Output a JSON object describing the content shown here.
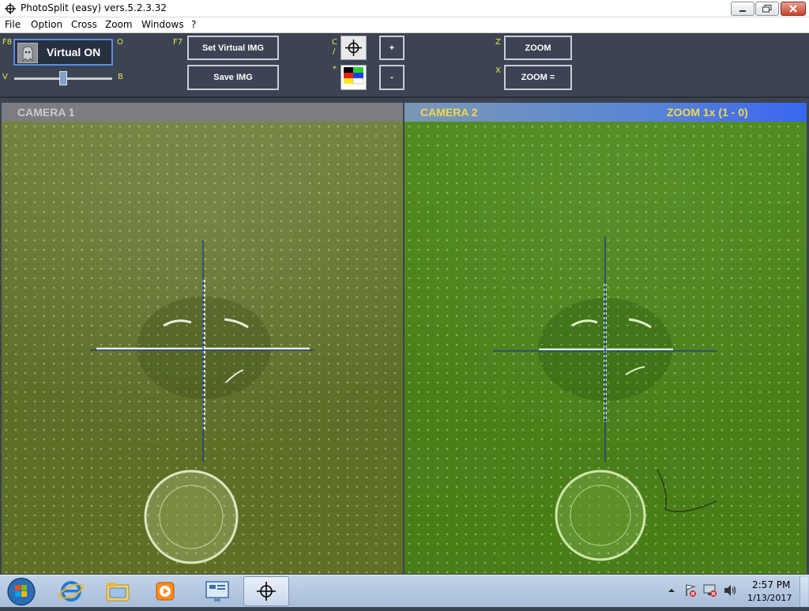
{
  "window": {
    "title": "PhotoSplit  (easy)  vers.5.2.3.32"
  },
  "menu": {
    "items": [
      "File",
      "Option",
      "Cross",
      "Zoom",
      "Windows",
      "?"
    ]
  },
  "toolbar": {
    "hotkeys": {
      "f8": "F8",
      "f7": "F7",
      "o": "O",
      "v": "V",
      "b": "B",
      "c": "C",
      "slash": "/",
      "star": "*",
      "z": "Z",
      "x": "X"
    },
    "virtual_label": "Virtual ON",
    "slider_value": 0.5,
    "set_virtual_label": "Set Virtual IMG",
    "save_label": "Save IMG",
    "plus_label": "+",
    "minus_label": "-",
    "zoom_label": "ZOOM",
    "zoom_equal_label": "ZOOM ="
  },
  "panels": {
    "camera1": {
      "title": "CAMERA 1"
    },
    "camera2": {
      "title": "CAMERA 2",
      "zoom_status": "ZOOM 1x (1 - 0)"
    }
  },
  "colors": {
    "accent": "#3a66f2",
    "toolbar_bg": "#3c4453",
    "hotkey": "#e6e64a",
    "camera2_title": "#f0d84a"
  },
  "taskbar": {
    "start_icon": "windows-orb-icon",
    "pinned": [
      "internet-explorer-icon",
      "file-explorer-icon",
      "media-player-icon",
      "control-panel-icon",
      "photosplit-crosshair-icon"
    ]
  },
  "clock": {
    "time": "2:57 PM",
    "date": "1/13/2017"
  }
}
